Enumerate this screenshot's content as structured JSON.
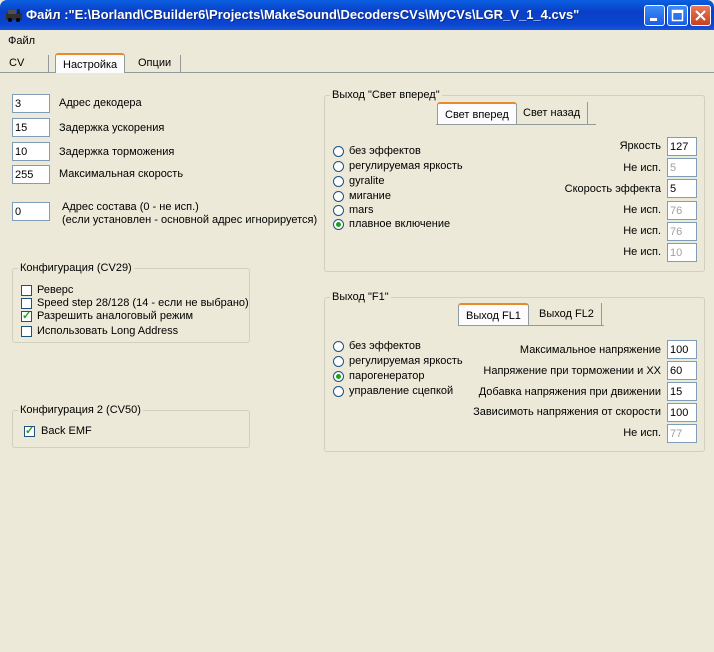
{
  "window": {
    "title": "Файл :\"E:\\Borland\\CBuilder6\\Projects\\MakeSound\\DecodersCVs\\MyCVs\\LGR_V_1_4.cvs\""
  },
  "menu": {
    "file": "Файл"
  },
  "tabs": [
    {
      "label": "CV",
      "active": false
    },
    {
      "label": "Настройка",
      "active": true
    },
    {
      "label": "Опции",
      "active": false
    }
  ],
  "decoder": {
    "address": {
      "value": "3",
      "label": "Адрес декодера"
    },
    "accel": {
      "value": "15",
      "label": "Задержка ускорения"
    },
    "decel": {
      "value": "10",
      "label": "Задержка торможения"
    },
    "max_speed": {
      "value": "255",
      "label": "Максимальная скорость"
    },
    "consist": {
      "value": "0",
      "label1": "Адрес состава  (0 - не исп.)",
      "label2": "(если установлен - основной адрес игнорируется)"
    }
  },
  "config29": {
    "title": "Конфигурация (CV29)",
    "items": [
      {
        "label": "Реверс",
        "checked": false
      },
      {
        "label": "Speed step 28/128 (14 - если не выбрано)",
        "checked": false
      },
      {
        "label": "Разрешить аналоговый режим",
        "checked": true
      },
      {
        "label": "Использовать Long Address",
        "checked": false
      }
    ]
  },
  "config50": {
    "title": "Конфигурация 2 (CV50)",
    "items": [
      {
        "label": "Back EMF",
        "checked": true
      }
    ]
  },
  "front_light": {
    "title": "Выход \"Свет вперед\"",
    "tabs": [
      {
        "label": "Свет вперед",
        "active": true
      },
      {
        "label": "Свет назад",
        "active": false
      }
    ],
    "radios": [
      {
        "label": "без эффектов",
        "selected": false
      },
      {
        "label": "регулируемая яркость",
        "selected": false
      },
      {
        "label": "gyralite",
        "selected": false
      },
      {
        "label": "мигание",
        "selected": false
      },
      {
        "label": "mars",
        "selected": false
      },
      {
        "label": "плавное включение",
        "selected": true
      }
    ],
    "params": [
      {
        "label": "Яркость",
        "value": "127",
        "disabled": false
      },
      {
        "label": "Не исп.",
        "value": "5",
        "disabled": true
      },
      {
        "label": "Скорость эффекта",
        "value": "5",
        "disabled": false
      },
      {
        "label": "Не исп.",
        "value": "76",
        "disabled": true
      },
      {
        "label": "Не исп.",
        "value": "76",
        "disabled": true
      },
      {
        "label": "Не исп.",
        "value": "10",
        "disabled": true
      }
    ]
  },
  "f1": {
    "title": "Выход \"F1\"",
    "tabs": [
      {
        "label": "Выход FL1",
        "active": true
      },
      {
        "label": "Выход FL2",
        "active": false
      }
    ],
    "radios": [
      {
        "label": "без эффектов",
        "selected": false
      },
      {
        "label": "регулируемая яркость",
        "selected": false
      },
      {
        "label": "парогенератор",
        "selected": true
      },
      {
        "label": "управление сцепкой",
        "selected": false
      }
    ],
    "params": [
      {
        "label": "Максимальное напряжение",
        "value": "100",
        "disabled": false
      },
      {
        "label": "Напряжение при торможении и ХХ",
        "value": "60",
        "disabled": false
      },
      {
        "label": "Добавка напряжения при движении",
        "value": "15",
        "disabled": false
      },
      {
        "label": "Зависимоть напряжения от скорости",
        "value": "100",
        "disabled": false
      },
      {
        "label": "Не исп.",
        "value": "77",
        "disabled": true
      }
    ]
  }
}
